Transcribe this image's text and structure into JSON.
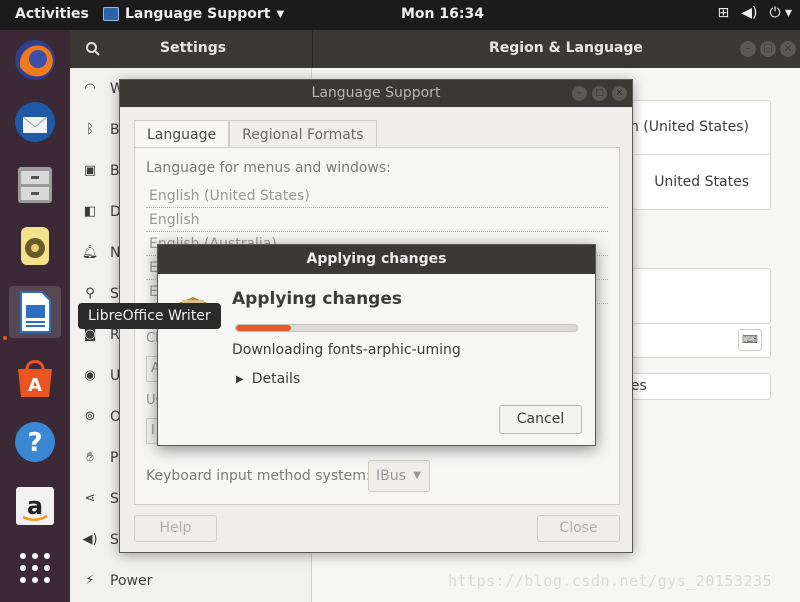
{
  "topbar": {
    "activities": "Activities",
    "app_name": "Language Support",
    "clock": "Mon 16:34",
    "tray_icons": [
      "network-icon",
      "volume-icon",
      "power-icon"
    ]
  },
  "dock": {
    "items": [
      {
        "name": "firefox-icon",
        "color": "#e8661e"
      },
      {
        "name": "thunderbird-icon",
        "color": "#2d6fb7"
      },
      {
        "name": "files-icon",
        "color": "#9a9a9a"
      },
      {
        "name": "rhythmbox-icon",
        "color": "#e8d36b"
      },
      {
        "name": "libreoffice-writer-icon",
        "color": "#2a6fc2"
      },
      {
        "name": "software-center-icon",
        "color": "#e95420"
      },
      {
        "name": "help-icon",
        "color": "#3a88d4"
      },
      {
        "name": "amazon-icon",
        "color": "#f1f1f1"
      },
      {
        "name": "show-apps-icon",
        "color": "#ffffff"
      }
    ],
    "tooltip": "LibreOffice Writer"
  },
  "settings": {
    "title": "Settings",
    "page_title": "Region & Language",
    "sidebar": [
      {
        "icon": "wifi-icon",
        "label": "W"
      },
      {
        "icon": "bluetooth-icon",
        "label": "B"
      },
      {
        "icon": "background-icon",
        "label": "B"
      },
      {
        "icon": "dock-icon",
        "label": "D"
      },
      {
        "icon": "notifications-icon",
        "label": "N"
      },
      {
        "icon": "search-icon",
        "label": "S"
      },
      {
        "icon": "region-icon",
        "label": "R"
      },
      {
        "icon": "universal-access-icon",
        "label": "U"
      },
      {
        "icon": "online-accounts-icon",
        "label": "O"
      },
      {
        "icon": "privacy-icon",
        "label": "P"
      },
      {
        "icon": "sharing-icon",
        "label": "S"
      },
      {
        "icon": "sound-icon",
        "label": "S"
      },
      {
        "icon": "power-icon",
        "label": "Power"
      }
    ],
    "panel": {
      "language_value": "sh (United States)",
      "formats_value": "United States",
      "manage_button": "ges"
    }
  },
  "language_support": {
    "title": "Language Support",
    "tabs": [
      "Language",
      "Regional Formats"
    ],
    "list_label": "Language for menus and windows:",
    "languages": [
      "English (United States)",
      "English",
      "English (Australia)",
      "E",
      "E"
    ],
    "obscured": [
      "Ch",
      "A",
      "Us",
      "I"
    ],
    "keyboard_label": "Keyboard input method system:",
    "keyboard_value": "IBus",
    "help_button": "Help",
    "close_button": "Close"
  },
  "apply": {
    "window_title": "Applying changes",
    "title": "Applying changes",
    "progress": 0.16,
    "status": "Downloading fonts-arphic-uming",
    "details": "Details",
    "cancel": "Cancel"
  },
  "watermark": "https://blog.csdn.net/gys_20153235",
  "colors": {
    "accent": "#e35a2c",
    "titlebar": "#3a3935",
    "dock": "#3b2a35"
  }
}
